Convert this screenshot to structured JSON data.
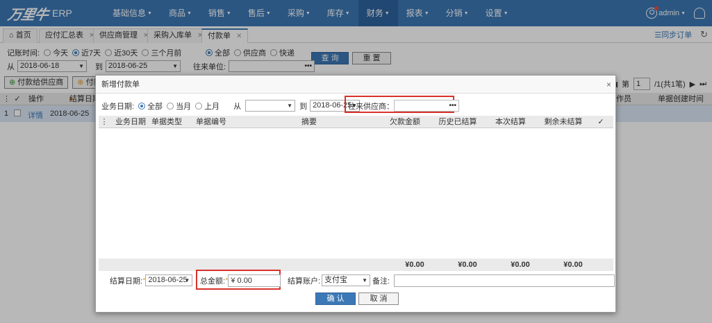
{
  "header": {
    "logo_mark": "万里牛",
    "logo_suffix": "ERP",
    "nav": [
      {
        "label": "基础信息",
        "active": false
      },
      {
        "label": "商品",
        "active": false
      },
      {
        "label": "销售",
        "active": false
      },
      {
        "label": "售后",
        "active": false
      },
      {
        "label": "采购",
        "active": false
      },
      {
        "label": "库存",
        "active": false
      },
      {
        "label": "财务",
        "active": true
      },
      {
        "label": "报表",
        "active": false
      },
      {
        "label": "分销",
        "active": false
      },
      {
        "label": "设置",
        "active": false
      }
    ],
    "user": "admin",
    "colors": {
      "bar": "#3c78b5",
      "active": "#2e65a0"
    }
  },
  "tabs": [
    {
      "label": "首页",
      "icon": "home-icon",
      "closable": false
    },
    {
      "label": "应付汇总表",
      "closable": true
    },
    {
      "label": "供应商管理",
      "closable": true
    },
    {
      "label": "采购入库单",
      "closable": true
    },
    {
      "label": "付款单",
      "closable": true,
      "active": true
    }
  ],
  "tab_actions": {
    "sync_orders": "同步订单"
  },
  "filters": {
    "record_time_label": "记账时间:",
    "time_options": [
      "今天",
      "近7天",
      "近30天",
      "三个月前"
    ],
    "time_selected": "近7天",
    "type_options": [
      "全部",
      "供应商",
      "快递"
    ],
    "type_selected": "全部",
    "from_label": "从",
    "from_date": "2018-06-18",
    "to_label": "到",
    "to_date": "2018-06-25",
    "partner_label": "往来单位:",
    "query": "查 询",
    "reset": "重 置"
  },
  "toolbar": {
    "pay_supplier": "付款给供应商",
    "pay_other": "付款"
  },
  "pager": {
    "page_label": "第",
    "page": "1",
    "total": "/1(共1笔)"
  },
  "grid": {
    "headers": [
      "操作",
      "结算日期",
      "作员",
      "单据创建时间"
    ],
    "rows": [
      {
        "index": "1",
        "op": "详情",
        "date": "2018-06-25"
      }
    ]
  },
  "modal": {
    "title": "新增付款单",
    "biz_date_label": "业务日期:",
    "date_options": [
      "全部",
      "当月",
      "上月"
    ],
    "date_selected": "全部",
    "from_label": "从",
    "from_value": "",
    "to_label": "到",
    "to_value": "2018-06-25",
    "supplier_label": "往来供应商：",
    "table_headers": [
      "业务日期",
      "单据类型",
      "单据编号",
      "摘要",
      "欠款金额",
      "历史已结算",
      "本次结算",
      "剩余未结算"
    ],
    "totals": [
      "¥0.00",
      "¥0.00",
      "¥0.00",
      "¥0.00"
    ],
    "settle_date_label": "结算日期:",
    "settle_date": "2018-06-25",
    "total_label": "总金额:",
    "total_value": "¥ 0.00",
    "account_label": "结算账户:",
    "account_value": "支付宝",
    "remark_label": "备注:",
    "confirm": "确 认",
    "cancel": "取 消"
  }
}
